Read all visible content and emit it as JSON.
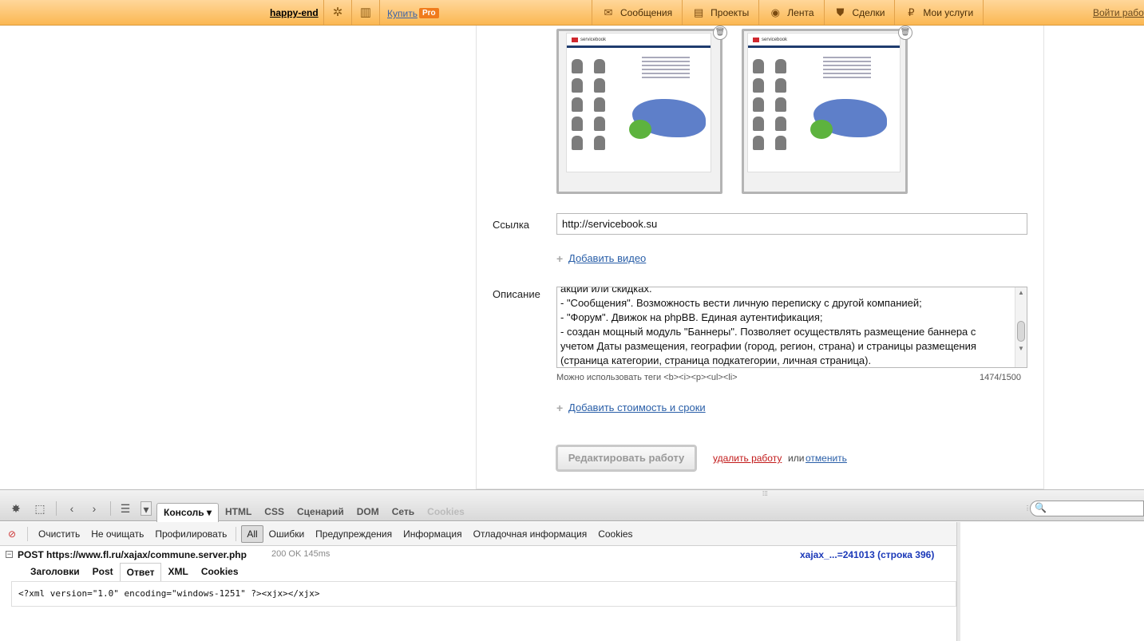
{
  "topbar": {
    "username": "happy-end",
    "buy_label": "Купить",
    "pro_badge": "Pro",
    "nav": [
      {
        "label": "Сообщения",
        "icon": "envelope-icon"
      },
      {
        "label": "Проекты",
        "icon": "document-icon"
      },
      {
        "label": "Лента",
        "icon": "chat-bubble-icon"
      },
      {
        "label": "Сделки",
        "icon": "shield-icon"
      },
      {
        "label": "Мои услуги",
        "icon": "ruble-coin-icon"
      }
    ],
    "login_label": "Войти работодателем"
  },
  "form": {
    "thumb_logo": "servicebook",
    "link_label": "Ссылка",
    "link_value": "http://servicebook.su",
    "add_video": "Добавить видео",
    "description_label": "Описание",
    "description_lines": [
      "акции или скидках.",
      "- \"Сообщения\". Возможность вести личную переписку с другой компанией;",
      "- \"Форум\". Движок на phpBB. Единая аутентификация;",
      "- создан мощный модуль \"Баннеры\". Позволяет осуществлять размещение баннера с",
      "учетом Даты размещения, географии (город, регион, страна) и страницы размещения",
      "(страница категории, страница подкатегории, личная страница)."
    ],
    "tags_hint": "Можно использовать теги <b><i><p><ul><li>",
    "char_counter": "1474/1500",
    "add_price": "Добавить стоимость и сроки",
    "edit_button": "Редактировать работу",
    "delete_link": "удалить работу",
    "or_text": "или",
    "cancel_link": "отменить"
  },
  "firebug": {
    "tabs": [
      {
        "label": "Консоль ▾",
        "active": true
      },
      {
        "label": "HTML"
      },
      {
        "label": "CSS"
      },
      {
        "label": "Сценарий"
      },
      {
        "label": "DOM"
      },
      {
        "label": "Сеть"
      },
      {
        "label": "Cookies",
        "dim": true
      }
    ],
    "console_buttons": [
      "Очистить",
      "Не очищать",
      "Профилировать"
    ],
    "filters": [
      "All",
      "Ошибки",
      "Предупреждения",
      "Информация",
      "Отладочная информация",
      "Cookies"
    ],
    "request": {
      "toggle": "−",
      "title": "POST https://www.fl.ru/xajax/commune.server.php",
      "status": "200 OK 145ms",
      "source": "xajax_...=241013 (строка 396)"
    },
    "response_tabs": [
      "Заголовки",
      "Post",
      "Ответ",
      "XML",
      "Cookies"
    ],
    "response_body": "<?xml version=\"1.0\" encoding=\"windows-1251\" ?><xjx></xjx>"
  },
  "colors": {
    "topbar": "#fbb852",
    "pro_badge": "#f07b1c",
    "link": "#2a5fa8",
    "delete": "#c21a1a",
    "request_source": "#1a38b8"
  }
}
